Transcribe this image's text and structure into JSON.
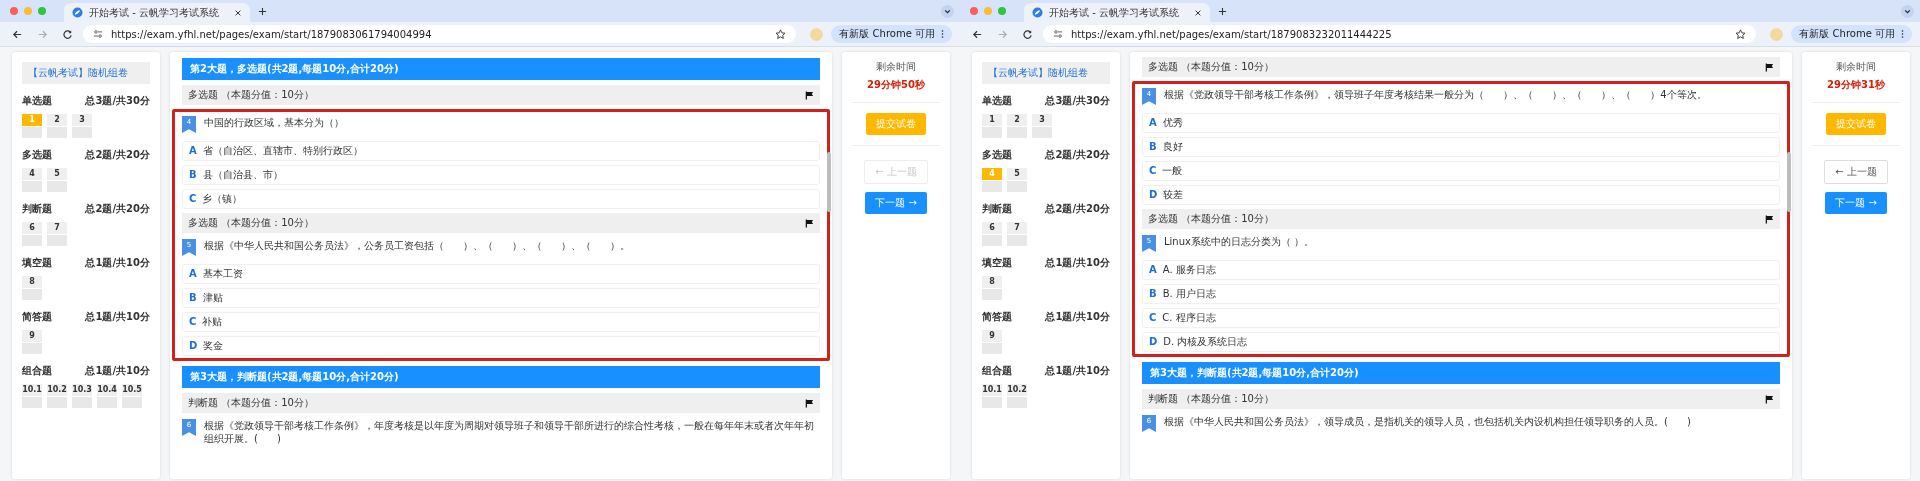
{
  "windows": [
    {
      "tab_title": "开始考试 - 云帆学习考试系统",
      "url": "https://exam.yfhl.net/pages/exam/start/1879083061794004994",
      "update_label": "有新版 Chrome 可用",
      "sidebar": {
        "title": "【云帆考试】随机组卷",
        "sections": [
          {
            "name": "单选题",
            "summary": "总3题/共30分",
            "items": [
              {
                "label": "1",
                "selected": true
              },
              {
                "label": "2",
                "selected": false
              },
              {
                "label": "3",
                "selected": false
              }
            ]
          },
          {
            "name": "多选题",
            "summary": "总2题/共20分",
            "items": [
              {
                "label": "4",
                "selected": false
              },
              {
                "label": "5",
                "selected": false
              }
            ]
          },
          {
            "name": "判断题",
            "summary": "总2题/共20分",
            "items": [
              {
                "label": "6",
                "selected": false
              },
              {
                "label": "7",
                "selected": false
              }
            ]
          },
          {
            "name": "填空题",
            "summary": "总1题/共10分",
            "items": [
              {
                "label": "8",
                "selected": false
              }
            ]
          },
          {
            "name": "简答题",
            "summary": "总1题/共10分",
            "items": [
              {
                "label": "9",
                "selected": false
              }
            ]
          },
          {
            "name": "组合题",
            "summary": "总1题/共10分",
            "items": [
              {
                "label": "10.1",
                "selected": false
              },
              {
                "label": "10.2",
                "selected": false
              },
              {
                "label": "10.3",
                "selected": false
              },
              {
                "label": "10.4",
                "selected": false
              },
              {
                "label": "10.5",
                "selected": false
              }
            ]
          }
        ]
      },
      "main": {
        "lead": [
          {
            "kind": "section",
            "text": "第2大题，多选题(共2题,每题10分,合计20分)"
          },
          {
            "kind": "header",
            "text": "多选题 （本题分值：10分）"
          }
        ],
        "highlighted": [
          {
            "kind": "question",
            "number": "4",
            "text": "中国的行政区域，基本分为（）"
          },
          {
            "kind": "option",
            "letter": "A",
            "text": "省（自治区、直辖市、特别行政区）"
          },
          {
            "kind": "option",
            "letter": "B",
            "text": "县（自治县、市）"
          },
          {
            "kind": "option",
            "letter": "C",
            "text": "乡（镇）"
          },
          {
            "kind": "header",
            "text": "多选题 （本题分值：10分）"
          },
          {
            "kind": "question",
            "number": "5",
            "text": "根据《中华人民共和国公务员法》，公务员工资包括（      ）、（      ）、（      ）、（      ）。"
          },
          {
            "kind": "option",
            "letter": "A",
            "text": "基本工资"
          },
          {
            "kind": "option",
            "letter": "B",
            "text": "津贴"
          },
          {
            "kind": "option",
            "letter": "C",
            "text": "补贴"
          },
          {
            "kind": "option",
            "letter": "D",
            "text": "奖金"
          }
        ],
        "trail": [
          {
            "kind": "section",
            "text": "第3大题，判断题(共2题,每题10分,合计20分)"
          },
          {
            "kind": "header",
            "text": "判断题 （本题分值：10分）"
          },
          {
            "kind": "question",
            "number": "6",
            "text": "根据《党政领导干部考核工作条例》，年度考核是以年度为周期对领导班子和领导干部所进行的综合性考核，一般在每年年末或者次年年初组织开展。(      )"
          }
        ]
      },
      "timer": {
        "label": "剩余时间",
        "time": "29分钟50秒",
        "submit": "提交试卷",
        "prev": {
          "label": "← 上一题",
          "disabled": true
        },
        "next": "下一题 →"
      }
    },
    {
      "tab_title": "开始考试 - 云帆学习考试系统",
      "url": "https://exam.yfhl.net/pages/exam/start/1879083232011444225",
      "update_label": "有新版 Chrome 可用",
      "sidebar": {
        "title": "【云帆考试】随机组卷",
        "sections": [
          {
            "name": "单选题",
            "summary": "总3题/共30分",
            "items": [
              {
                "label": "1",
                "selected": false
              },
              {
                "label": "2",
                "selected": false
              },
              {
                "label": "3",
                "selected": false
              }
            ]
          },
          {
            "name": "多选题",
            "summary": "总2题/共20分",
            "items": [
              {
                "label": "4",
                "selected": true
              },
              {
                "label": "5",
                "selected": false
              }
            ]
          },
          {
            "name": "判断题",
            "summary": "总2题/共20分",
            "items": [
              {
                "label": "6",
                "selected": false
              },
              {
                "label": "7",
                "selected": false
              }
            ]
          },
          {
            "name": "填空题",
            "summary": "总1题/共10分",
            "items": [
              {
                "label": "8",
                "selected": false
              }
            ]
          },
          {
            "name": "简答题",
            "summary": "总1题/共10分",
            "items": [
              {
                "label": "9",
                "selected": false
              }
            ]
          },
          {
            "name": "组合题",
            "summary": "总1题/共10分",
            "items": [
              {
                "label": "10.1",
                "selected": false
              },
              {
                "label": "10.2",
                "selected": false
              }
            ]
          }
        ]
      },
      "main": {
        "lead": [
          {
            "kind": "header",
            "text": "多选题 （本题分值：10分）"
          }
        ],
        "highlighted": [
          {
            "kind": "question",
            "number": "4",
            "text": "根据《党政领导干部考核工作条例》，领导班子年度考核结果一般分为（      ）、（      ）、（      ）、（      ）4个等次。"
          },
          {
            "kind": "option",
            "letter": "A",
            "text": "优秀"
          },
          {
            "kind": "option",
            "letter": "B",
            "text": "良好"
          },
          {
            "kind": "option",
            "letter": "C",
            "text": "一般"
          },
          {
            "kind": "option",
            "letter": "D",
            "text": "较差"
          },
          {
            "kind": "header",
            "text": "多选题 （本题分值：10分）"
          },
          {
            "kind": "question",
            "number": "5",
            "text": "Linux系统中的日志分类为（ ）。"
          },
          {
            "kind": "option",
            "letter": "A",
            "text": "A. 服务日志"
          },
          {
            "kind": "option",
            "letter": "B",
            "text": "B. 用户日志"
          },
          {
            "kind": "option",
            "letter": "C",
            "text": "C. 程序日志"
          },
          {
            "kind": "option",
            "letter": "D",
            "text": "D. 内核及系统日志"
          }
        ],
        "trail": [
          {
            "kind": "section",
            "text": "第3大题，判断题(共2题,每题10分,合计20分)"
          },
          {
            "kind": "header",
            "text": "判断题 （本题分值：10分）"
          },
          {
            "kind": "question",
            "number": "6",
            "text": "根据《中华人民共和国公务员法》，领导成员，是指机关的领导人员，也包括机关内设机构担任领导职务的人员。(      )"
          }
        ]
      },
      "timer": {
        "label": "剩余时间",
        "time": "29分钟31秒",
        "submit": "提交试卷",
        "prev": {
          "label": "← 上一题",
          "disabled": false
        },
        "next": "下一题 →"
      }
    }
  ]
}
